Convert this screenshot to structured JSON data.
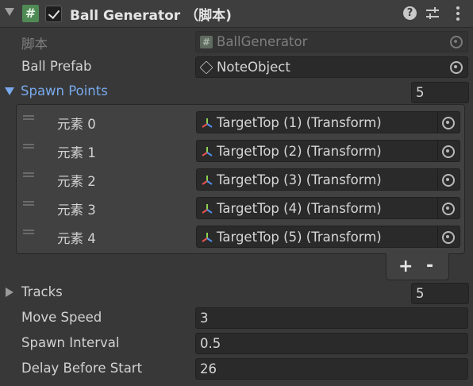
{
  "header": {
    "title": "Ball Generator （脚本)",
    "script_icon_glyph": "#",
    "help_glyph": "?",
    "enabled": true
  },
  "script_field": {
    "label": "脚本",
    "value": "BallGenerator",
    "icon": "script-icon"
  },
  "ball_prefab": {
    "label": "Ball Prefab",
    "value": "NoteObject",
    "icon": "prefab-cube-icon"
  },
  "spawn_points": {
    "label": "Spawn Points",
    "size": "5",
    "expanded": true,
    "elements": [
      {
        "label": "元素 0",
        "value": "TargetTop (1) (Transform)"
      },
      {
        "label": "元素 1",
        "value": "TargetTop (2) (Transform)"
      },
      {
        "label": "元素 2",
        "value": "TargetTop (3) (Transform)"
      },
      {
        "label": "元素 3",
        "value": "TargetTop (4) (Transform)"
      },
      {
        "label": "元素 4",
        "value": "TargetTop (5) (Transform)"
      }
    ],
    "add_label": "+",
    "remove_label": "-"
  },
  "tracks": {
    "label": "Tracks",
    "size": "5",
    "expanded": false
  },
  "move_speed": {
    "label": "Move Speed",
    "value": "3"
  },
  "spawn_interval": {
    "label": "Spawn Interval",
    "value": "0.5"
  },
  "delay_before_start": {
    "label": "Delay Before Start",
    "value": "26"
  },
  "colors": {
    "background": "#383838",
    "field": "#2a2a2a",
    "accent_blue": "#78a9ec",
    "script_green": "#4f8a55"
  }
}
